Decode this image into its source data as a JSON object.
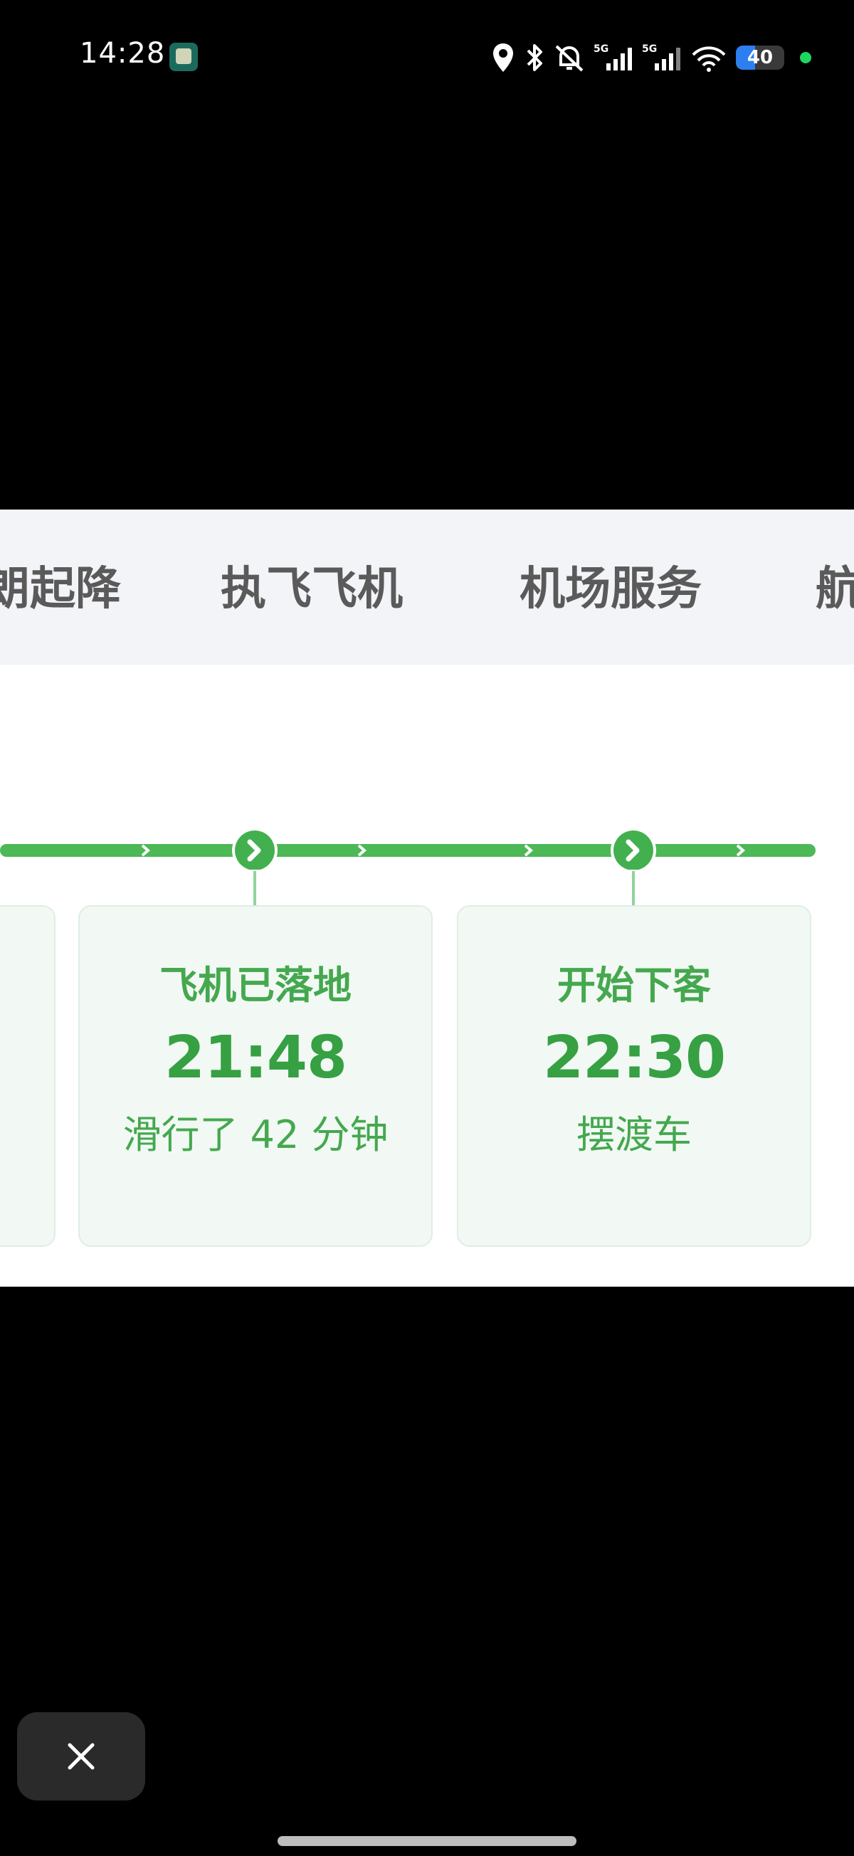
{
  "status_bar": {
    "time": "14:28",
    "battery_level": "40",
    "icons": [
      "location-icon",
      "bluetooth-icon",
      "bell-muted-icon",
      "signal-5g-icon",
      "signal-5g-icon",
      "wifi-icon",
      "battery-icon"
    ]
  },
  "tabs": [
    {
      "label": "朗起降"
    },
    {
      "label": "执飞飞机"
    },
    {
      "label": "机场服务"
    },
    {
      "label": "航"
    }
  ],
  "timeline": {
    "accent_color": "#4cb856",
    "cards": [
      {
        "title": "飞机已落地",
        "time": "21:48",
        "subtitle": "滑行了 42 分钟"
      },
      {
        "title": "开始下客",
        "time": "22:30",
        "subtitle": "摆渡车"
      }
    ]
  },
  "controls": {
    "close_icon": "close-icon"
  }
}
